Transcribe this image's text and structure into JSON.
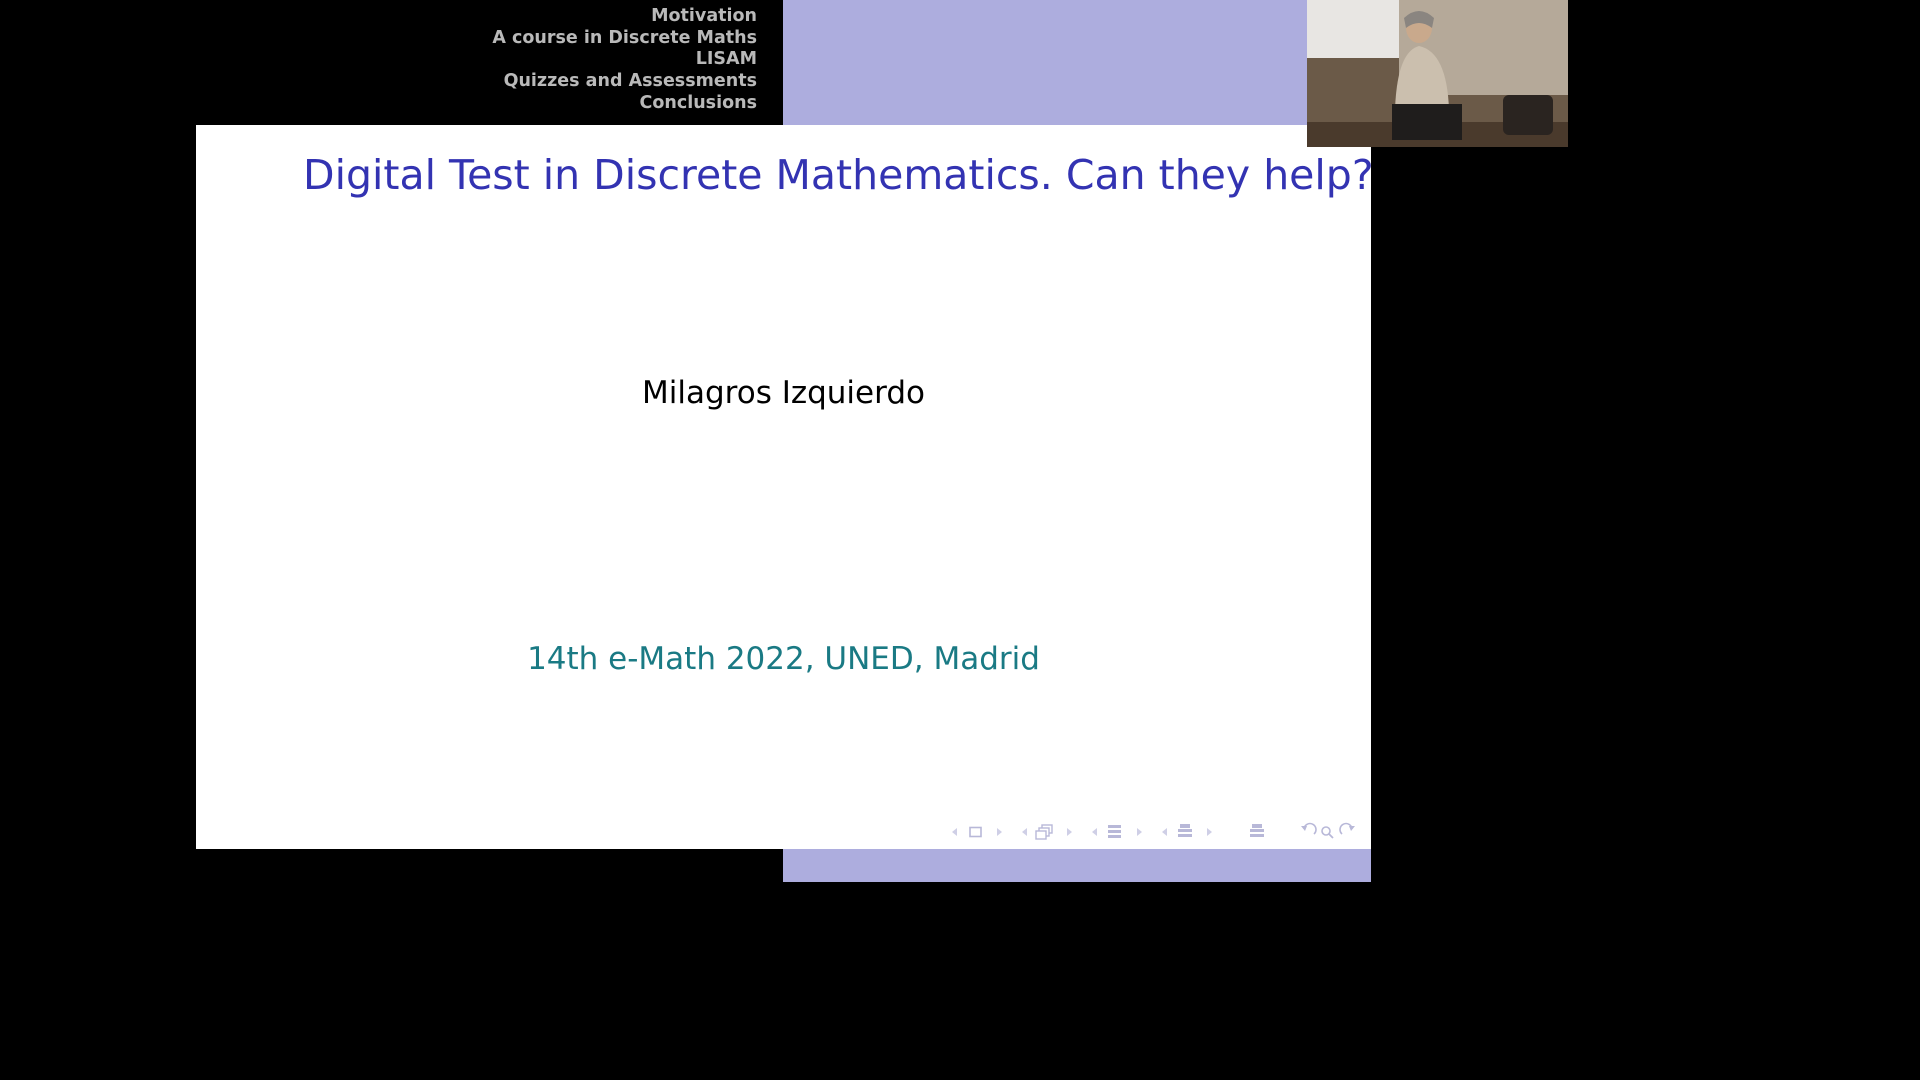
{
  "header": {
    "sections": [
      "Motivation",
      "A course in Discrete Maths",
      "LISAM",
      "Quizzes and Assessments",
      "Conclusions"
    ]
  },
  "slide": {
    "title": "Digital Test in Discrete Mathematics.  Can they help?",
    "author": "Milagros Izquierdo",
    "event": "14th e-Math 2022, UNED, Madrid"
  },
  "beamer_nav": [
    "frame-nav",
    "subsection-nav",
    "section-nav",
    "document-nav",
    "appendix-nav",
    "back-find-forward-nav"
  ],
  "colors": {
    "title": "#3333b2",
    "event": "#1a7a84",
    "header_band": "#adadde",
    "nav_text": "#b9b9b9"
  },
  "webcam": {
    "alt": "presenter"
  }
}
